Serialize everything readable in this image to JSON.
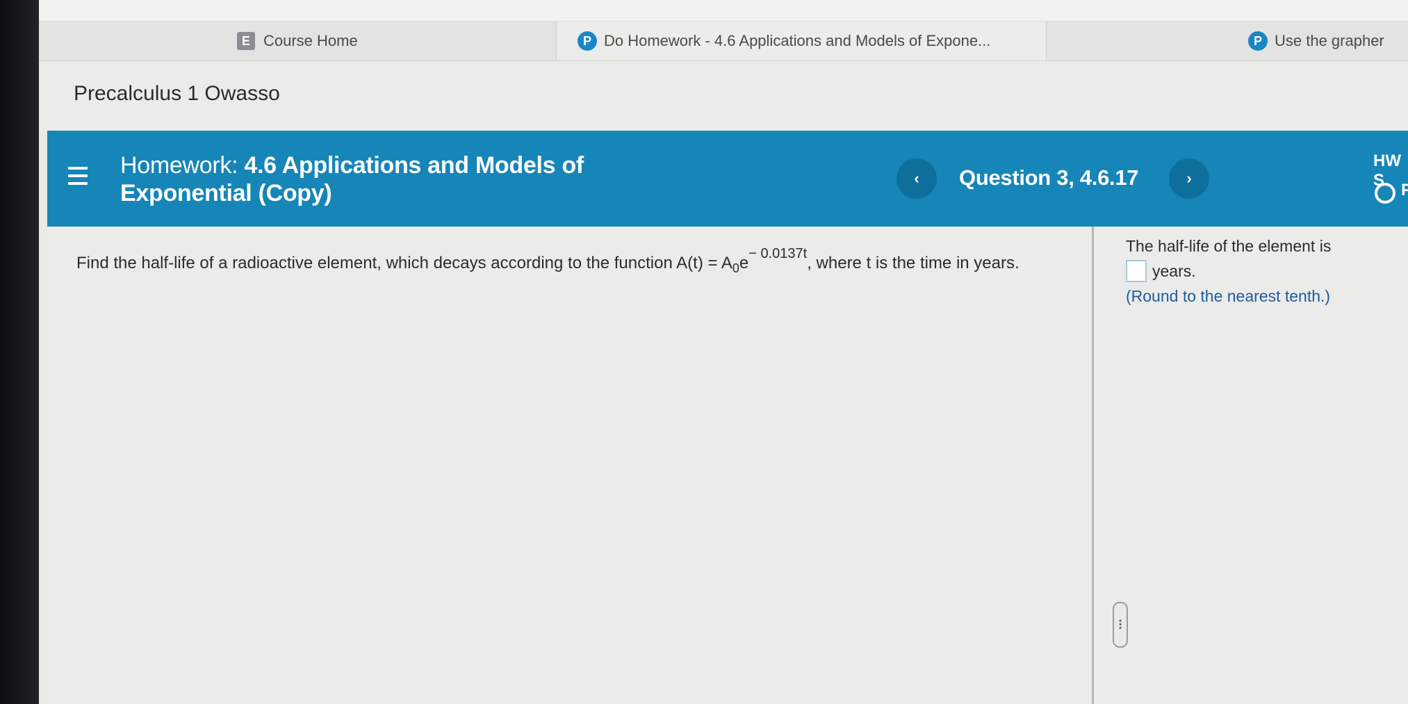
{
  "tabs": [
    {
      "icon": "E",
      "label": "Course Home"
    },
    {
      "icon": "P",
      "label": "Do Homework - 4.6 Applications and Models of Expone..."
    },
    {
      "icon": "P",
      "label": "Use the grapher"
    }
  ],
  "course": {
    "title": "Precalculus 1 Owasso"
  },
  "homework": {
    "title_prefix": "Homework: ",
    "title_bold_1": "4.6 Applications and Models of",
    "title_bold_2": "Exponential (Copy)",
    "prev_symbol": "‹",
    "next_symbol": "›",
    "question_label": "Question 3, 4.6.17",
    "score_label": "HW S",
    "score_letter": "F"
  },
  "question": {
    "text_before": "Find the half-life of a radioactive element, which decays according to the function A(t) = A",
    "sub": "0",
    "base": "e",
    "exponent": "− 0.0137t",
    "text_after": ", where t is the time in years."
  },
  "answer": {
    "line1": "The half-life of the element is",
    "unit": "years.",
    "hint": "(Round to the nearest tenth.)",
    "value": ""
  },
  "colors": {
    "header_bg": "#1685b8",
    "accent": "#1b86c5",
    "hint": "#1d5d9c"
  }
}
